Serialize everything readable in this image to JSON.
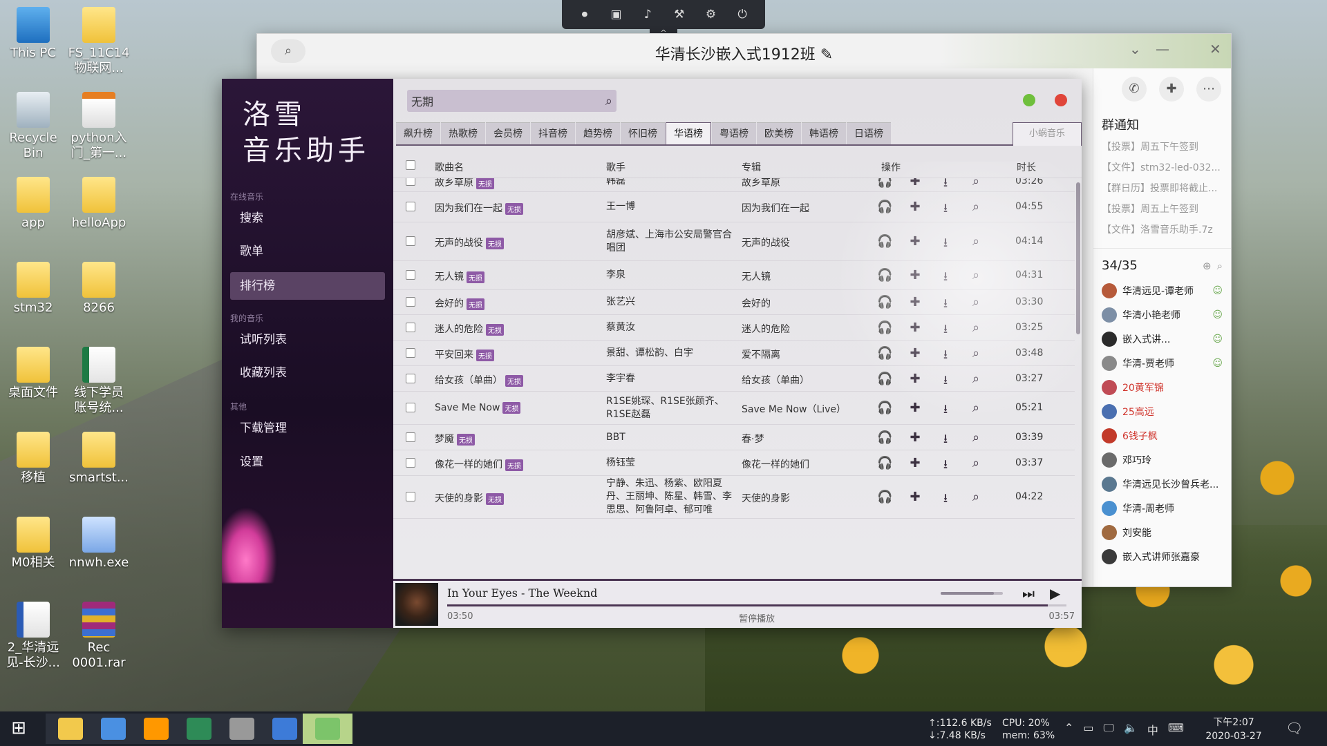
{
  "desktop": {
    "icons": [
      {
        "label": "This PC",
        "kind": "pc-icon"
      },
      {
        "label": "FS_11C14\n物联网...",
        "kind": "folder-icon"
      },
      {
        "label": "Recycle\nBin",
        "kind": "recycle-bin-icon"
      },
      {
        "label": "python入\n门_第一...",
        "kind": "pdf-icon"
      },
      {
        "label": "app",
        "kind": "folder-icon"
      },
      {
        "label": "helloApp",
        "kind": "folder-icon"
      },
      {
        "label": "stm32",
        "kind": "folder-icon"
      },
      {
        "label": "8266",
        "kind": "folder-icon"
      },
      {
        "label": "桌面文件",
        "kind": "folder-icon"
      },
      {
        "label": "线下学员\n账号统...",
        "kind": "excel-icon"
      },
      {
        "label": "移植",
        "kind": "folder-icon"
      },
      {
        "label": "smartst...",
        "kind": "folder-icon"
      },
      {
        "label": "M0相关",
        "kind": "folder-icon"
      },
      {
        "label": "nnwh.exe",
        "kind": "exe-icon"
      },
      {
        "label": "2_华清远\n见-长沙...",
        "kind": "word-icon"
      },
      {
        "label": "Rec\n0001.rar",
        "kind": "rar-icon"
      }
    ]
  },
  "top_toolbar": {
    "icons": [
      "record-icon",
      "screen-icon",
      "mic-icon",
      "tools-icon",
      "settings-icon",
      "power-icon"
    ]
  },
  "chat": {
    "title": "华清长沙嵌入式1912班",
    "edit_icon": "✎",
    "notice_title": "群通知",
    "notices": [
      "【投票】周五下午签到",
      "【文件】stm32-led-032...",
      "【群日历】投票即将截止...",
      "【投票】周五上午签到",
      "【文件】洛雪音乐助手.7z"
    ],
    "member_count": "34/35",
    "members": [
      {
        "name": "华清远见-谭老师",
        "role": true,
        "red": false,
        "color": "#b65a3a"
      },
      {
        "name": "华清小艳老师",
        "role": true,
        "red": false,
        "color": "#7d8fa6"
      },
      {
        "name": "嵌入式讲...",
        "role": true,
        "red": false,
        "color": "#2b2b2b"
      },
      {
        "name": "华清-贾老师",
        "role": true,
        "red": false,
        "color": "#8a8a8a"
      },
      {
        "name": "20黄军锦",
        "role": false,
        "red": true,
        "color": "#c04b55"
      },
      {
        "name": "25高远",
        "role": false,
        "red": true,
        "color": "#4a6fb0"
      },
      {
        "name": "6钱子枫",
        "role": false,
        "red": true,
        "color": "#c23a2a"
      },
      {
        "name": "邓巧玲",
        "role": false,
        "red": false,
        "color": "#6a6a6a"
      },
      {
        "name": "华清远见长沙曾兵老...",
        "role": false,
        "red": false,
        "color": "#5a7890"
      },
      {
        "name": "华清-周老师",
        "role": false,
        "red": false,
        "color": "#4a90d0"
      },
      {
        "name": "刘安能",
        "role": false,
        "red": false,
        "color": "#a06a40"
      },
      {
        "name": "嵌入式讲师张嘉豪",
        "role": false,
        "red": false,
        "color": "#3a3a3a"
      }
    ]
  },
  "app": {
    "logo_line1": "洛雪",
    "logo_line2": "音乐助手",
    "groups": {
      "online": "在线音乐",
      "mine": "我的音乐",
      "other": "其他"
    },
    "nav": {
      "search": "搜索",
      "playlist": "歌单",
      "charts": "排行榜",
      "trial_list": "试听列表",
      "favorites": "收藏列表",
      "downloads": "下载管理",
      "settings": "设置"
    },
    "search": {
      "value": "无期"
    },
    "colors": {
      "min_dot": "#6fbf3c",
      "close_dot": "#e0453a",
      "accent": "#4b3553",
      "lossless_tag": "#8e5aa6"
    },
    "tabs": [
      "飙升榜",
      "热歌榜",
      "会员榜",
      "抖音榜",
      "趋势榜",
      "怀旧榜",
      "华语榜",
      "粤语榜",
      "欧美榜",
      "韩语榜",
      "日语榜"
    ],
    "active_tab": "华语榜",
    "source_tab": "小蜗音乐",
    "columns": {
      "song": "歌曲名",
      "artist": "歌手",
      "album": "专辑",
      "ops": "操作",
      "duration": "时长"
    },
    "tag_label": "无损",
    "songs": [
      {
        "name": "故乡草原",
        "artist": "韩磊",
        "album": "故乡草原",
        "duration": "03:26"
      },
      {
        "name": "因为我们在一起",
        "artist": "王一博",
        "album": "因为我们在一起",
        "duration": "04:55"
      },
      {
        "name": "无声的战役",
        "artist": "胡彦斌、上海市公安局警官合唱团",
        "album": "无声的战役",
        "duration": "04:14"
      },
      {
        "name": "无人镜",
        "artist": "李泉",
        "album": "无人镜",
        "duration": "04:31"
      },
      {
        "name": "会好的",
        "artist": "张艺兴",
        "album": "会好的",
        "duration": "03:30"
      },
      {
        "name": "迷人的危险",
        "artist": "蔡黄汝",
        "album": "迷人的危险",
        "duration": "03:25"
      },
      {
        "name": "平安回来",
        "artist": "景甜、谭松韵、白宇",
        "album": "爱不隔离",
        "duration": "03:48"
      },
      {
        "name": "给女孩（单曲）",
        "artist": "李宇春",
        "album": "给女孩（单曲）",
        "duration": "03:27"
      },
      {
        "name": "Save Me Now",
        "artist": "R1SE姚琛、R1SE张颜齐、R1SE赵磊",
        "album": "Save Me Now（Live）",
        "duration": "05:21"
      },
      {
        "name": "梦魇",
        "artist": "BBT",
        "album": "春·梦",
        "duration": "03:39"
      },
      {
        "name": "像花一样的她们",
        "artist": "杨钰莹",
        "album": "像花一样的她们",
        "duration": "03:37"
      },
      {
        "name": "天使的身影",
        "artist": "宁静、朱迅、杨紫、欧阳夏丹、王丽坤、陈星、韩雪、李思思、阿鲁阿卓、郁可唯",
        "album": "天使的身影",
        "duration": "04:22"
      }
    ],
    "player": {
      "track": "In Your Eyes - The Weeknd",
      "current": "03:50",
      "status": "暂停播放",
      "total": "03:57",
      "progress_fraction": 0.97,
      "volume_fraction": 0.85
    }
  },
  "taskbar": {
    "apps": [
      "file-explorer-icon",
      "chrome-icon",
      "sublime-icon",
      "vim-icon",
      "app-icon",
      "keil-icon",
      "music-icon"
    ],
    "net_up": "↑:112.6 KB/s",
    "net_down": "↓:7.48 KB/s",
    "cpu": "CPU:  20%",
    "mem": "mem: 63%",
    "ime": "中",
    "time": "下午2:07",
    "date": "2020-03-27"
  }
}
